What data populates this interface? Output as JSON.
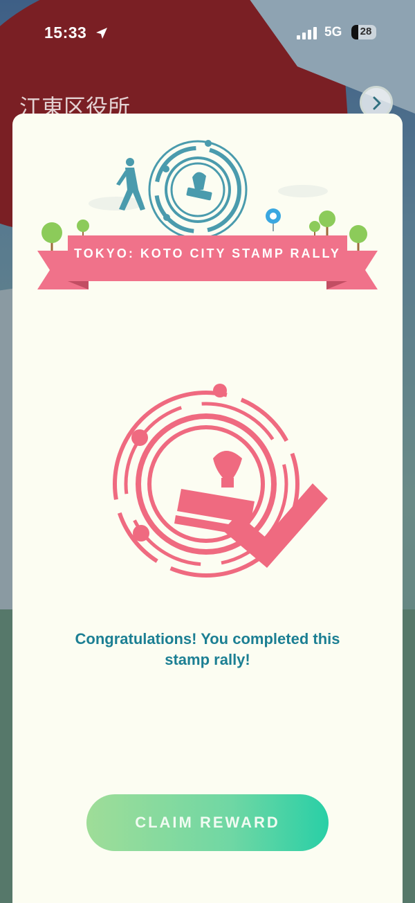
{
  "status_bar": {
    "time": "15:33",
    "network": "5G",
    "battery": "28"
  },
  "place": {
    "title": "江東区役所"
  },
  "card": {
    "banner_title": "TOKYO: KOTO CITY STAMP RALLY",
    "message": "Congratulations! You completed this stamp rally!",
    "claim_label": "CLAIM REWARD"
  },
  "icons": {
    "location": "location-arrow-icon",
    "signal": "signal-bars-icon",
    "next": "chevron-right-icon",
    "stamp": "stamp-icon",
    "check": "checkmark-icon"
  },
  "colors": {
    "banner_pink": "#f0728a",
    "stamp_pink": "#ef6a80",
    "teal": "#4a9bad",
    "message_teal": "#1c7f93",
    "button_start": "#9fdd98",
    "button_end": "#29cfa6",
    "card_bg": "#fcfdf2"
  }
}
